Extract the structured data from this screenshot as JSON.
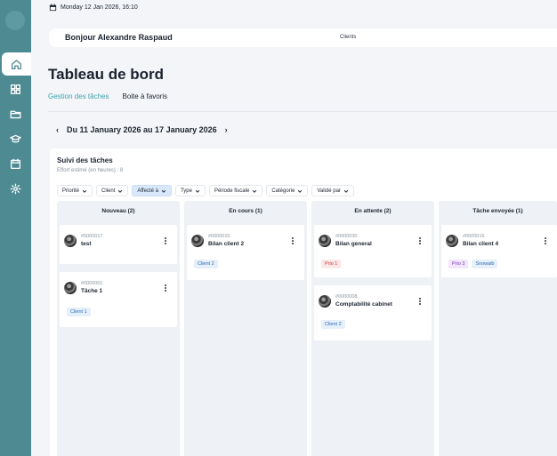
{
  "sidebar": {
    "items": [
      {
        "icon": "home-icon",
        "active": true
      },
      {
        "icon": "grid-icon",
        "active": false
      },
      {
        "icon": "folder-icon",
        "active": false
      },
      {
        "icon": "graduation-cap-icon",
        "active": false
      },
      {
        "icon": "calendar-icon",
        "active": false
      },
      {
        "icon": "gear-icon",
        "active": false
      }
    ]
  },
  "topbar": {
    "datetime": "Monday 12 Jan 2026, 16:10"
  },
  "header": {
    "greeting": "Bonjour Alexandre Raspaud",
    "clients_link": "Clients"
  },
  "page": {
    "title": "Tableau de bord"
  },
  "tabs": [
    {
      "label": "Gestion des tâches",
      "active": true
    },
    {
      "label": "Boite à favoris",
      "active": false
    }
  ],
  "week": {
    "label": "Du 11 January 2026 au 17 January 2026",
    "prev": "‹",
    "next": "›"
  },
  "tracking": {
    "title": "Suivi des tâches",
    "effort": "Effort estimé (en heures) : 8",
    "filters": [
      {
        "label": "Priorité",
        "active": false
      },
      {
        "label": "Client",
        "active": false
      },
      {
        "label": "Affecté à",
        "active": true
      },
      {
        "label": "Type",
        "active": false
      },
      {
        "label": "Période fiscale",
        "active": false
      },
      {
        "label": "Catégorie",
        "active": false
      },
      {
        "label": "Validé par",
        "active": false
      }
    ]
  },
  "columns": [
    {
      "title": "Nouveau (2)",
      "cards": [
        {
          "id": "#0000017",
          "name": "test",
          "tags": []
        },
        {
          "id": "#0000001",
          "name": "Tâche 1",
          "tags": [
            {
              "label": "Client 1",
              "kind": "client"
            }
          ]
        }
      ]
    },
    {
      "title": "En cours (1)",
      "cards": [
        {
          "id": "#0000010",
          "name": "Bilan client 2",
          "tags": [
            {
              "label": "Client 2",
              "kind": "client"
            }
          ]
        }
      ]
    },
    {
      "title": "En attente (2)",
      "cards": [
        {
          "id": "#0000030",
          "name": "Bilan general",
          "tags": [
            {
              "label": "Prio 1",
              "kind": "prio1"
            }
          ]
        },
        {
          "id": "#0000008",
          "name": "Comptabilité cabinet",
          "tags": [
            {
              "label": "Client 2",
              "kind": "client"
            }
          ]
        }
      ]
    },
    {
      "title": "Tâche envoyée (1)",
      "cards": [
        {
          "id": "#0000016",
          "name": "Bilan client 4",
          "tags": [
            {
              "label": "Prio 3",
              "kind": "prio3"
            },
            {
              "label": "Snowaib",
              "kind": "show"
            }
          ]
        }
      ]
    }
  ]
}
